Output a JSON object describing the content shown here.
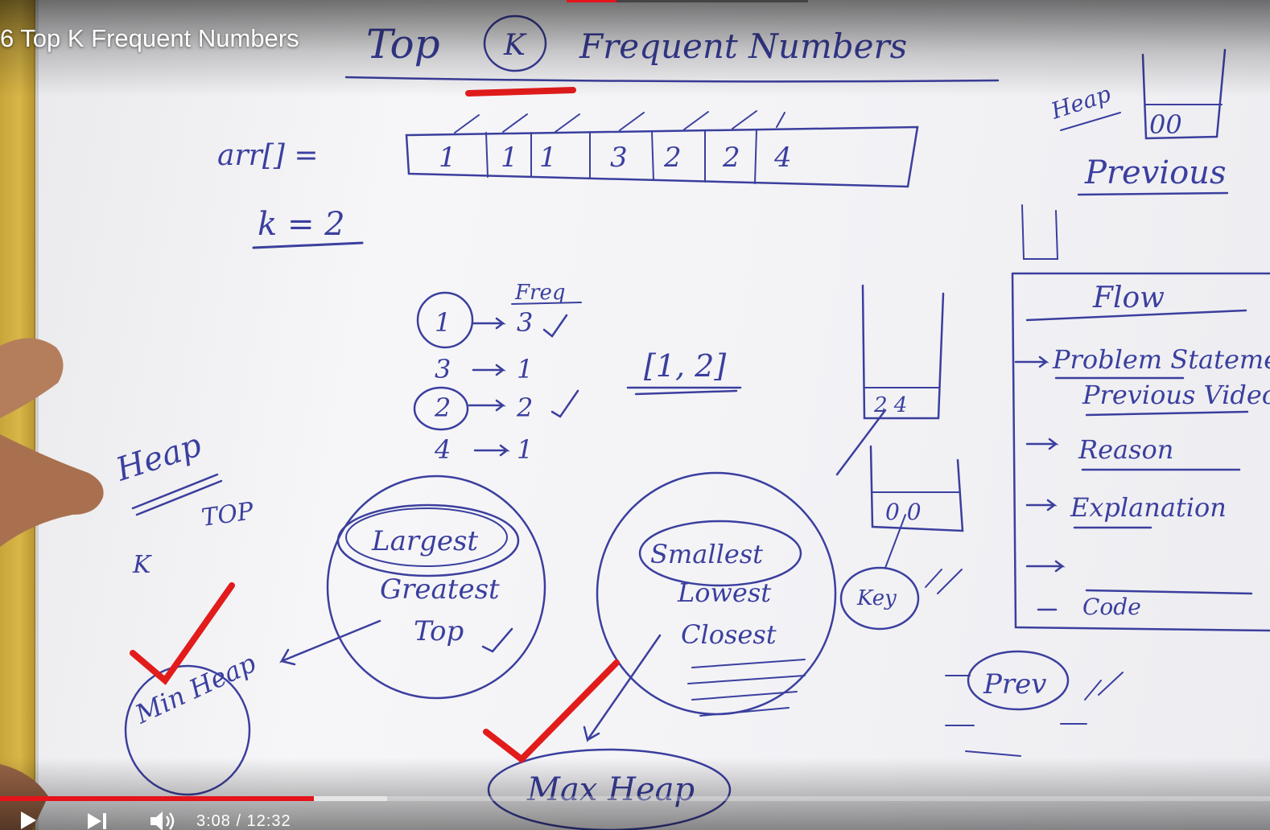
{
  "video": {
    "title": "6 Top K Frequent Numbers",
    "time_display": "3:08 / 12:32"
  },
  "player": {
    "progress_played": 0.247,
    "progress_buffered": 0.305,
    "accent_color": "#e5131a",
    "icons": [
      "play-icon",
      "next-icon",
      "volume-icon"
    ]
  },
  "whiteboard": {
    "heading": "Top K Frequent Numbers",
    "array_label": "arr[] =",
    "array_values": [
      "1",
      "1",
      "1",
      "3",
      "2",
      "2",
      "4"
    ],
    "k_label": "k = 2",
    "freq_header": "Freq",
    "freq_rows": [
      {
        "num": "1",
        "freq": "3"
      },
      {
        "num": "3",
        "freq": "1"
      },
      {
        "num": "2",
        "freq": "2"
      },
      {
        "num": "4",
        "freq": "1"
      }
    ],
    "result": "[1, 2]",
    "heap_label": "Heap",
    "top_label": "TOP",
    "k_small": "K",
    "min_heap": "Min Heap",
    "max_heap": "Max Heap",
    "largest_circle": [
      "Largest",
      "Greatest",
      "Top"
    ],
    "smallest_circle": [
      "Smallest",
      "Lowest",
      "Closest"
    ],
    "key_label": "Key",
    "prev_label": "Prev",
    "previous_label": "Previous",
    "flow_title": "Flow",
    "flow_items": [
      "Problem Statement",
      "Previous Video",
      "Reason",
      "Explanation",
      "Code"
    ],
    "heap_values_top": "00",
    "heap_values_mid": "2 4",
    "heap_values_low": "0 0",
    "ink_color": "#3b3f9e",
    "marker_color": "#e21b1b"
  }
}
